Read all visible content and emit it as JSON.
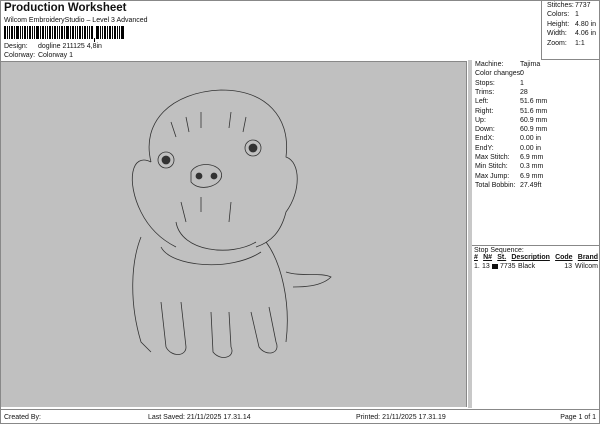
{
  "header": {
    "title": "Production Worksheet",
    "subtitle": "Wilcom EmbroideryStudio – Level 3 Advanced",
    "design_label": "Design:",
    "design_value": "dogline 211125 4,8in",
    "colorway_label": "Colorway:",
    "colorway_value": "Colorway 1"
  },
  "summary": [
    {
      "k": "Stitches:",
      "v": "7737"
    },
    {
      "k": "Colors:",
      "v": "1"
    },
    {
      "k": "Height:",
      "v": "4.80 in"
    },
    {
      "k": "Width:",
      "v": "4.06 in"
    },
    {
      "k": "Zoom:",
      "v": "1:1"
    }
  ],
  "stats": [
    {
      "k": "Machine:",
      "v": "Tajima"
    },
    {
      "k": "Color changes:",
      "v": "0"
    },
    {
      "k": "Stops:",
      "v": "1"
    },
    {
      "k": "Trims:",
      "v": "28"
    },
    {
      "k": "Left:",
      "v": "51.6 mm"
    },
    {
      "k": "Right:",
      "v": "51.6 mm"
    },
    {
      "k": "Up:",
      "v": "60.9 mm"
    },
    {
      "k": "Down:",
      "v": "60.9 mm"
    },
    {
      "k": "EndX:",
      "v": "0.00 in"
    },
    {
      "k": "EndY:",
      "v": "0.00 in"
    },
    {
      "k": "Max Stitch:",
      "v": "6.9 mm"
    },
    {
      "k": "Min Stitch:",
      "v": "0.3 mm"
    },
    {
      "k": "Max Jump:",
      "v": "6.9 mm"
    },
    {
      "k": "Total Bobbin:",
      "v": "27.49ft"
    }
  ],
  "stop_sequence": {
    "title": "Stop Sequence:",
    "headers": [
      "#",
      "N#",
      "St.",
      "Description",
      "Code",
      "Brand"
    ],
    "rows": [
      {
        "num": "1.",
        "n": "13",
        "color": "#111111",
        "st": "7735",
        "desc": "Black",
        "code": "13",
        "brand": "Wilcom"
      }
    ]
  },
  "footer": {
    "created": "Created By:",
    "saved": "Last Saved: 21/11/2025 17.31.14",
    "printed": "Printed: 21/11/2025 17.31.19",
    "page": "Page 1 of 1"
  }
}
